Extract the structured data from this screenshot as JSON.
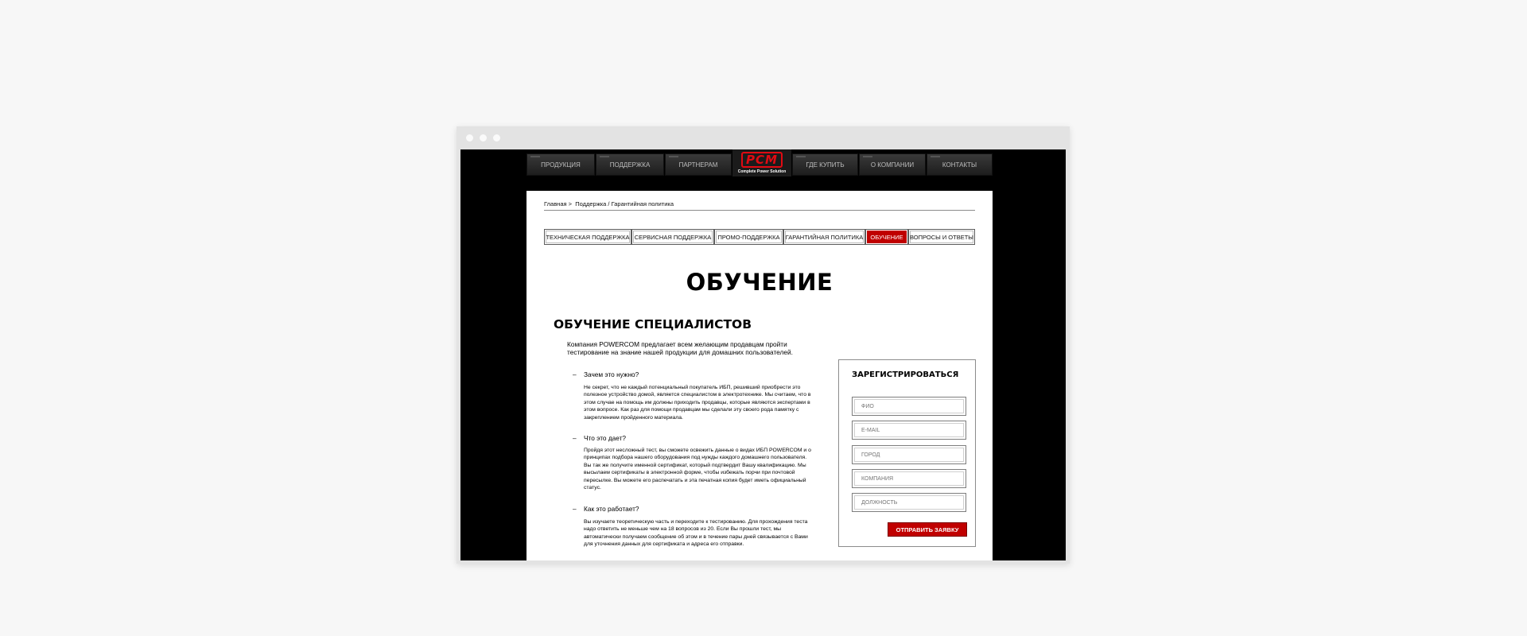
{
  "nav": {
    "items": [
      "ПРОДУКЦИЯ",
      "ПОДДЕРЖКА",
      "ПАРТНЕРАМ",
      "ГДЕ КУПИТЬ",
      "О КОМПАНИИ",
      "КОНТАКТЫ"
    ],
    "logo_text": "PCM",
    "logo_tagline": "Complete Power Solution"
  },
  "breadcrumb": {
    "home": "Главная",
    "separator": ">",
    "trail": "Поддержка / Гарантийная политика"
  },
  "tabs": [
    {
      "label": "ТЕХНИЧЕСКАЯ ПОДДЕРЖКА",
      "active": false
    },
    {
      "label": "СЕРВИСНАЯ ПОДДЕРЖКА",
      "active": false
    },
    {
      "label": "ПРОМО-ПОДДЕРЖКА",
      "active": false
    },
    {
      "label": "ГАРАНТИЙНАЯ ПОЛИТИКА",
      "active": false
    },
    {
      "label": "ОБУЧЕНИЕ",
      "active": true
    },
    {
      "label": "ВОПРОСЫ И ОТВЕТЫ",
      "active": false
    }
  ],
  "page_title": "ОБУЧЕНИЕ",
  "section_title": "ОБУЧЕНИЕ СПЕЦИАЛИСТОВ",
  "intro": "Компания POWERCOM предлагает всем желающим продавцам пройти тестирование на знание нашей продукции для домашних пользователей.",
  "faq": [
    {
      "dash": "–",
      "question": "Зачем это нужно?",
      "answer": "Не секрет, что не каждый потенциальный покупатель ИБП, решивший приобрести это полезное устройство домой, является специалистом в электротехнике. Мы считаем, что в этом случае на помощь им должны приходить продавцы, которые являются экспертами в этом вопросе. Как раз для помощи продавцам мы сделали эту своего рода памятку с закреплением пройденного материала."
    },
    {
      "dash": "–",
      "question": "Что это дает?",
      "answer": "Пройдя этот несложный тест, вы сможете освежить данные о видах ИБП POWERCOM и о принципах подбора нашего оборудования под нужды каждого домашнего пользователя. Вы так же получите именной сертификат, который подтвердит Вашу квалификацию. Мы высылаем сертификаты в электронной форме, чтобы избежать порчи при почтовой пересылке. Вы можете его распечатать и эта печатная копия будет иметь официальный статус."
    },
    {
      "dash": "–",
      "question": "Как это работает?",
      "answer": "Вы изучаете теоретическую часть и переходите к тестированию. Для прохождения теста надо ответить не меньше чем на 18 вопросов из 20. Если Вы прошли тест, мы автоматически получаем сообщение об этом и в течение пары дней связывается с Вами для уточнения данных для сертификата и адреса его отправки."
    }
  ],
  "form": {
    "title": "ЗАРЕГИСТРИРОВАТЬСЯ",
    "fields": [
      {
        "placeholder": "ФИО"
      },
      {
        "placeholder": "E-MAIL"
      },
      {
        "placeholder": "ГОРОД"
      },
      {
        "placeholder": "КОМПАНИЯ"
      },
      {
        "placeholder": "ДОЛЖНОСТЬ"
      }
    ],
    "submit_label": "ОТПРАВИТЬ ЗАЯВКУ"
  },
  "colors": {
    "accent": "#c00000",
    "logo_red": "#e10a12",
    "page_background": "#000000"
  }
}
